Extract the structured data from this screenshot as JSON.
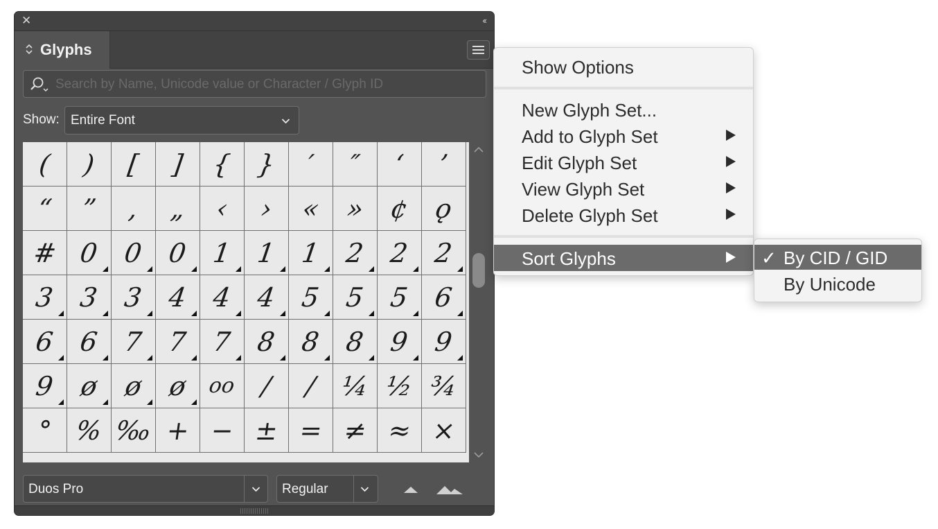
{
  "panel": {
    "title": "Glyphs",
    "search_placeholder": "Search by Name, Unicode value or Character / Glyph ID",
    "show_label": "Show:",
    "show_value": "Entire Font",
    "font_family": "Duos Pro",
    "font_style": "Regular"
  },
  "glyphs": [
    {
      "c": "(",
      "alt": false
    },
    {
      "c": ")",
      "alt": false
    },
    {
      "c": "[",
      "alt": false
    },
    {
      "c": "]",
      "alt": false
    },
    {
      "c": "{",
      "alt": false
    },
    {
      "c": "}",
      "alt": false
    },
    {
      "c": "′",
      "alt": false
    },
    {
      "c": "″",
      "alt": false
    },
    {
      "c": "‘",
      "alt": false
    },
    {
      "c": "’",
      "alt": false
    },
    {
      "c": "“",
      "alt": false
    },
    {
      "c": "”",
      "alt": false
    },
    {
      "c": "‚",
      "alt": false
    },
    {
      "c": "„",
      "alt": false
    },
    {
      "c": "‹",
      "alt": false
    },
    {
      "c": "›",
      "alt": false
    },
    {
      "c": "«",
      "alt": false
    },
    {
      "c": "»",
      "alt": false
    },
    {
      "c": "¢",
      "alt": false
    },
    {
      "c": "ǫ",
      "alt": false
    },
    {
      "c": "#",
      "alt": false
    },
    {
      "c": "0",
      "alt": true
    },
    {
      "c": "0",
      "alt": true
    },
    {
      "c": "0",
      "alt": true
    },
    {
      "c": "1",
      "alt": true
    },
    {
      "c": "1",
      "alt": true
    },
    {
      "c": "1",
      "alt": true
    },
    {
      "c": "2",
      "alt": true
    },
    {
      "c": "2",
      "alt": true
    },
    {
      "c": "2",
      "alt": true
    },
    {
      "c": "3",
      "alt": true
    },
    {
      "c": "3",
      "alt": true
    },
    {
      "c": "3",
      "alt": true
    },
    {
      "c": "4",
      "alt": true
    },
    {
      "c": "4",
      "alt": true
    },
    {
      "c": "4",
      "alt": true
    },
    {
      "c": "5",
      "alt": true
    },
    {
      "c": "5",
      "alt": true
    },
    {
      "c": "5",
      "alt": true
    },
    {
      "c": "6",
      "alt": true
    },
    {
      "c": "6",
      "alt": true
    },
    {
      "c": "6",
      "alt": true
    },
    {
      "c": "7",
      "alt": true
    },
    {
      "c": "7",
      "alt": true
    },
    {
      "c": "7",
      "alt": true
    },
    {
      "c": "8",
      "alt": true
    },
    {
      "c": "8",
      "alt": true
    },
    {
      "c": "8",
      "alt": true
    },
    {
      "c": "9",
      "alt": true
    },
    {
      "c": "9",
      "alt": true
    },
    {
      "c": "9",
      "alt": true
    },
    {
      "c": "ø",
      "alt": true
    },
    {
      "c": "ø",
      "alt": true
    },
    {
      "c": "ø",
      "alt": true
    },
    {
      "c": "oo",
      "alt": false
    },
    {
      "c": "/",
      "alt": false
    },
    {
      "c": "/",
      "alt": false
    },
    {
      "c": "¼",
      "alt": false
    },
    {
      "c": "½",
      "alt": false
    },
    {
      "c": "¾",
      "alt": false
    },
    {
      "c": "°",
      "alt": false
    },
    {
      "c": "%",
      "alt": false
    },
    {
      "c": "‰",
      "alt": false
    },
    {
      "c": "+",
      "alt": false
    },
    {
      "c": "−",
      "alt": false
    },
    {
      "c": "±",
      "alt": false
    },
    {
      "c": "=",
      "alt": false
    },
    {
      "c": "≠",
      "alt": false
    },
    {
      "c": "≈",
      "alt": false
    },
    {
      "c": "×",
      "alt": false
    }
  ],
  "menu": {
    "show_options": "Show Options",
    "new_glyph_set": "New Glyph Set...",
    "add_to_glyph_set": "Add to Glyph Set",
    "edit_glyph_set": "Edit Glyph Set",
    "view_glyph_set": "View Glyph Set",
    "delete_glyph_set": "Delete Glyph Set",
    "sort_glyphs": "Sort Glyphs"
  },
  "submenu": {
    "check": "✓",
    "by_cid_gid": "By CID / GID",
    "by_unicode": "By Unicode"
  }
}
